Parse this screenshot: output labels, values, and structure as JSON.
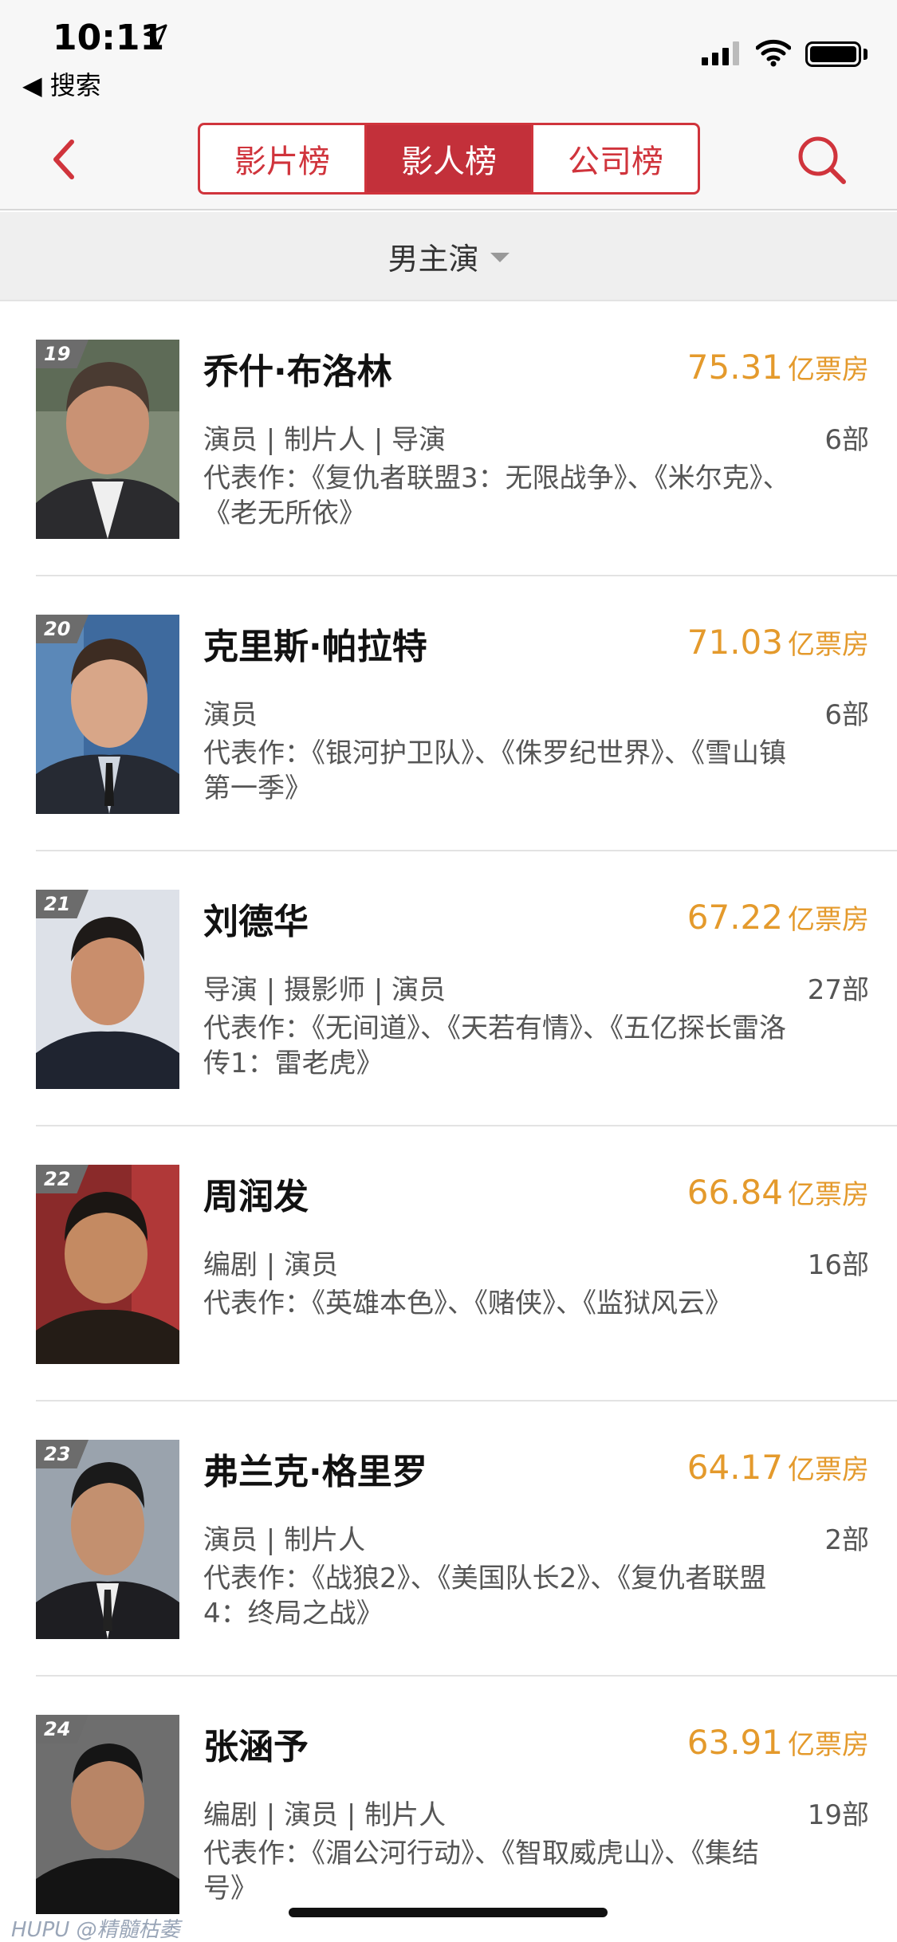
{
  "status_bar": {
    "time": "10:11",
    "back_app": "◀ 搜索"
  },
  "navbar": {
    "tabs": [
      {
        "label": "影片榜",
        "active": false
      },
      {
        "label": "影人榜",
        "active": true
      },
      {
        "label": "公司榜",
        "active": false
      }
    ],
    "accent": "#d0343c"
  },
  "filter": {
    "label": "男主演"
  },
  "list": [
    {
      "rank": "19",
      "name": "乔什·布洛林",
      "box_office": "75.31",
      "unit": "亿票房",
      "roles": "演员 | 制片人 | 导演",
      "count": "6部",
      "works": "代表作：《复仇者联盟3：无限战争》、《米尔克》、《老无所依》"
    },
    {
      "rank": "20",
      "name": "克里斯·帕拉特",
      "box_office": "71.03",
      "unit": "亿票房",
      "roles": "演员",
      "count": "6部",
      "works": "代表作：《银河护卫队》、《侏罗纪世界》、《雪山镇 第一季》"
    },
    {
      "rank": "21",
      "name": "刘德华",
      "box_office": "67.22",
      "unit": "亿票房",
      "roles": "导演 | 摄影师 | 演员",
      "count": "27部",
      "works": "代表作：《无间道》、《天若有情》、《五亿探长雷洛传1：雷老虎》"
    },
    {
      "rank": "22",
      "name": "周润发",
      "box_office": "66.84",
      "unit": "亿票房",
      "roles": "编剧 | 演员",
      "count": "16部",
      "works": "代表作：《英雄本色》、《赌侠》、《监狱风云》"
    },
    {
      "rank": "23",
      "name": "弗兰克·格里罗",
      "box_office": "64.17",
      "unit": "亿票房",
      "roles": "演员 | 制片人",
      "count": "2部",
      "works": "代表作：《战狼2》、《美国队长2》、《复仇者联盟4：终局之战》"
    },
    {
      "rank": "24",
      "name": "张涵予",
      "box_office": "63.91",
      "unit": "亿票房",
      "roles": "编剧 | 演员 | 制片人",
      "count": "19部",
      "works": "代表作：《湄公河行动》、《智取威虎山》、《集结号》"
    }
  ],
  "watermark": "HUPU @精髓枯萎",
  "icons": [
    "location-arrow-icon",
    "signal-icon",
    "wifi-icon",
    "battery-icon",
    "back-chevron-icon",
    "search-icon",
    "dropdown-caret-icon"
  ]
}
